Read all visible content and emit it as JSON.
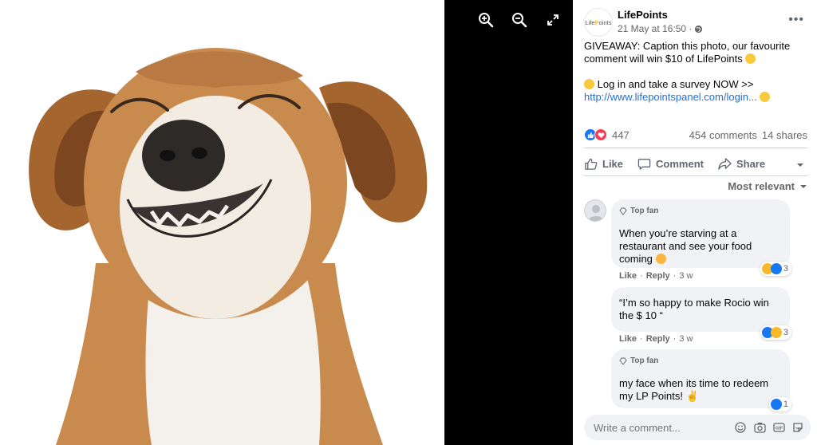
{
  "viewer": {
    "toolbar": [
      {
        "name": "zoom-in-icon"
      },
      {
        "name": "zoom-out-icon"
      },
      {
        "name": "fullscreen-icon"
      }
    ]
  },
  "post": {
    "page_name": "LifePoints",
    "avatar_logo": "LifePoints",
    "timestamp": "21 May at 16:50 ·",
    "text_line1": "GIVEAWAY: Caption this photo, our favourite comment will win $10 of LifePoints",
    "text_line2": "Log in and take a survey NOW >>",
    "link": "http://www.lifepointspanel.com/login...",
    "reaction_count": "447",
    "comments_count": "454 comments",
    "shares_count": "14 shares",
    "actions": {
      "like": "Like",
      "comment": "Comment",
      "share": "Share"
    },
    "sort_label": "Most relevant"
  },
  "comments": [
    {
      "badge": "Top fan",
      "text": "When you’re starving at a restaurant and see your food coming",
      "reactions": "3",
      "like": "Like",
      "reply": "Reply",
      "sep": "·",
      "time": "3 w"
    },
    {
      "text": "“I’m so happy to make Rocio win the $ 10 “",
      "reactions": "3",
      "like": "Like",
      "reply": "Reply",
      "sep": "·",
      "time": "3 w"
    },
    {
      "badge": "Top fan",
      "text": "my face when its time to redeem my LP Points!",
      "reactions": "1"
    }
  ],
  "composer": {
    "placeholder": "Write a comment...",
    "icons": [
      "emoji-icon",
      "camera-icon",
      "gif-icon",
      "sticker-icon"
    ]
  },
  "colors": {
    "link": "#216fdb",
    "like_blue": "#1877f2",
    "love_red": "#f33e58",
    "panel_bg": "#ffffff",
    "viewer_bg": "#000000"
  }
}
